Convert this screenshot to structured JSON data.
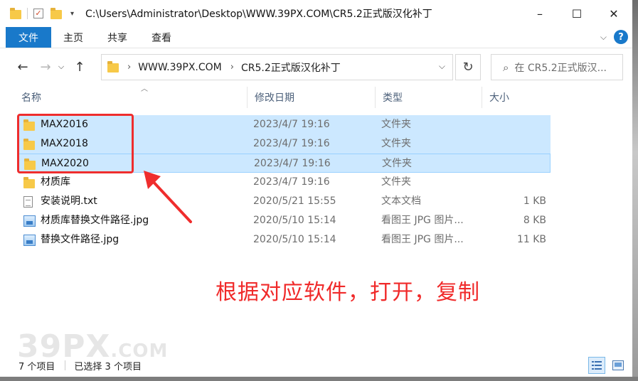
{
  "window": {
    "title": "C:\\Users\\Administrator\\Desktop\\WWW.39PX.COM\\CR5.2正式版汉化补丁",
    "controls": [
      "–",
      "☐",
      "✕"
    ]
  },
  "ribbon": {
    "tabs": [
      "文件",
      "主页",
      "共享",
      "查看"
    ],
    "help": "?"
  },
  "address": {
    "crumbs": [
      "WWW.39PX.COM",
      "CR5.2正式版汉化补丁"
    ],
    "search_placeholder": "在 CR5.2正式版汉..."
  },
  "columns": {
    "name": "名称",
    "date": "修改日期",
    "type": "类型",
    "size": "大小"
  },
  "files": [
    {
      "name": "MAX2016",
      "date": "2023/4/7 19:16",
      "type": "文件夹",
      "size": "",
      "icon": "folder-icon",
      "selected": true
    },
    {
      "name": "MAX2018",
      "date": "2023/4/7 19:16",
      "type": "文件夹",
      "size": "",
      "icon": "folder-icon",
      "selected": true
    },
    {
      "name": "MAX2020",
      "date": "2023/4/7 19:16",
      "type": "文件夹",
      "size": "",
      "icon": "folder-icon",
      "selected": true
    },
    {
      "name": "材质库",
      "date": "2023/4/7 19:16",
      "type": "文件夹",
      "size": "",
      "icon": "folder-icon",
      "selected": false
    },
    {
      "name": "安装说明.txt",
      "date": "2020/5/21 15:55",
      "type": "文本文档",
      "size": "1 KB",
      "icon": "txt-icon",
      "selected": false
    },
    {
      "name": "材质库替换文件路径.jpg",
      "date": "2020/5/10 15:14",
      "type": "看图王 JPG 图片...",
      "size": "8 KB",
      "icon": "image-icon",
      "selected": false
    },
    {
      "name": "替换文件路径.jpg",
      "date": "2020/5/10 15:14",
      "type": "看图王 JPG 图片...",
      "size": "11 KB",
      "icon": "image-icon",
      "selected": false
    }
  ],
  "annotation": {
    "text": "根据对应软件，打开，复制",
    "color": "#ef2d2d"
  },
  "watermark": {
    "main": "39PX",
    "suffix": ".COM"
  },
  "status": {
    "count": "7 个项目",
    "selected": "已选择 3 个项目"
  },
  "colors": {
    "file_tab": "#1979ca",
    "selection": "#cce8ff",
    "annotation_red": "#ef2d2d"
  }
}
